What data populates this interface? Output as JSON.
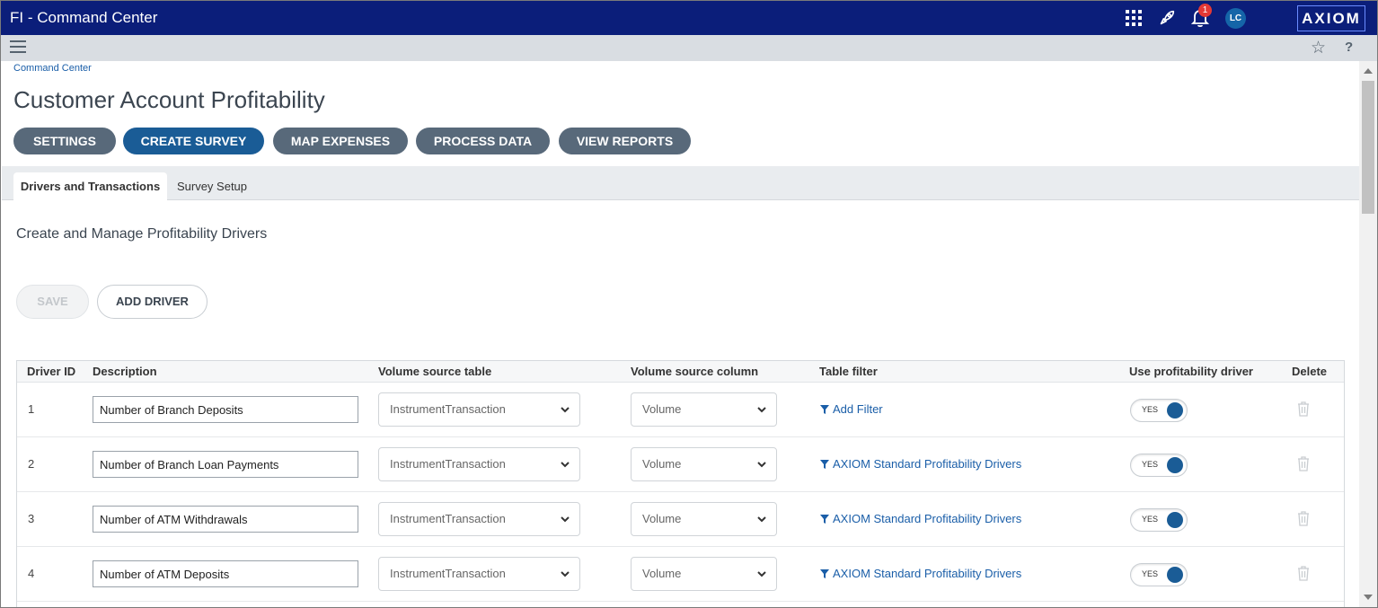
{
  "header": {
    "app_title": "FI - Command Center",
    "notification_count": "1",
    "avatar_initials": "LC",
    "logo_text": "AXIOM",
    "icons": [
      "apps-grid-icon",
      "rocket-icon",
      "bell-icon",
      "star-icon",
      "help-icon",
      "menu-icon"
    ]
  },
  "breadcrumb": "Command Center",
  "page_title": "Customer Account Profitability",
  "nav_buttons": [
    {
      "label": "SETTINGS",
      "active": false
    },
    {
      "label": "CREATE SURVEY",
      "active": true
    },
    {
      "label": "MAP EXPENSES",
      "active": false
    },
    {
      "label": "PROCESS DATA",
      "active": false
    },
    {
      "label": "VIEW REPORTS",
      "active": false
    }
  ],
  "tabs": [
    {
      "label": "Drivers and Transactions",
      "active": true
    },
    {
      "label": "Survey Setup",
      "active": false
    }
  ],
  "section_title": "Create and Manage Profitability Drivers",
  "actions": {
    "save_label": "SAVE",
    "add_driver_label": "ADD DRIVER"
  },
  "table": {
    "columns": [
      "Driver ID",
      "Description",
      "Volume source table",
      "Volume source column",
      "Table filter",
      "Use profitability driver",
      "Delete"
    ],
    "rows": [
      {
        "id": "1",
        "description": "Number of Branch Deposits",
        "source_table": "InstrumentTransaction",
        "source_column": "Volume",
        "filter": "Add Filter",
        "use_driver": "YES"
      },
      {
        "id": "2",
        "description": "Number of Branch Loan Payments",
        "source_table": "InstrumentTransaction",
        "source_column": "Volume",
        "filter": "AXIOM Standard Profitability Drivers",
        "use_driver": "YES"
      },
      {
        "id": "3",
        "description": "Number of ATM Withdrawals",
        "source_table": "InstrumentTransaction",
        "source_column": "Volume",
        "filter": "AXIOM Standard Profitability Drivers",
        "use_driver": "YES"
      },
      {
        "id": "4",
        "description": "Number of ATM Deposits",
        "source_table": "InstrumentTransaction",
        "source_column": "Volume",
        "filter": "AXIOM Standard Profitability Drivers",
        "use_driver": "YES"
      }
    ]
  },
  "colors": {
    "topbar": "#0b1e7a",
    "nav_button": "#58697a",
    "nav_button_active": "#1a5c96",
    "link": "#1a5ea8",
    "badge": "#e53935"
  }
}
